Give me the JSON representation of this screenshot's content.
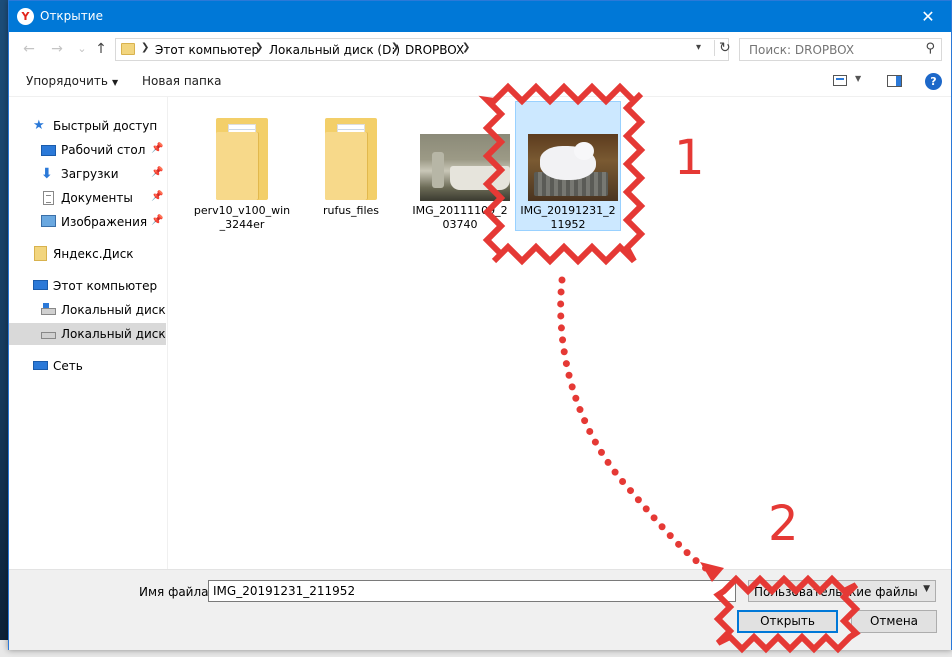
{
  "window": {
    "title": "Открытие",
    "close_glyph": "✕"
  },
  "nav": {
    "back_glyph": "←",
    "forward_glyph": "→",
    "history_glyph": "⌄",
    "up_glyph": "↑",
    "breadcrumbs": [
      "Этот компьютер",
      "Локальный диск (D:)",
      "DROPBOX"
    ],
    "search_placeholder": "Поиск: DROPBOX"
  },
  "toolbar": {
    "organize_label": "Упорядочить",
    "new_folder_label": "Новая папка",
    "help_glyph": "?"
  },
  "sidebar": {
    "items": [
      {
        "label": "Быстрый доступ",
        "icon": "star-icon"
      },
      {
        "label": "Рабочий стол",
        "icon": "desktop-icon",
        "pinned": true
      },
      {
        "label": "Загрузки",
        "icon": "download-icon",
        "pinned": true
      },
      {
        "label": "Документы",
        "icon": "documents-icon",
        "pinned": true
      },
      {
        "label": "Изображения",
        "icon": "pictures-icon",
        "pinned": true
      },
      {
        "label": "Яндекс.Диск",
        "icon": "folder-icon"
      },
      {
        "label": "Этот компьютер",
        "icon": "computer-icon"
      },
      {
        "label": "Локальный диск (C",
        "icon": "system-drive-icon"
      },
      {
        "label": "Локальный диск (D",
        "icon": "drive-icon",
        "selected": true
      },
      {
        "label": "Сеть",
        "icon": "network-icon"
      }
    ]
  },
  "files": [
    {
      "name": "perv10_v100_win_3244er",
      "type": "folder"
    },
    {
      "name": "rufus_files",
      "type": "folder"
    },
    {
      "name": "IMG_20111109_203740",
      "type": "image"
    },
    {
      "name": "IMG_20191231_211952",
      "type": "image",
      "selected": true
    }
  ],
  "bottom": {
    "filename_label": "Имя файла:",
    "filename_value": "IMG_20191231_211952",
    "filetype_value": "Пользовательские файлы",
    "open_label": "Открыть",
    "cancel_label": "Отмена"
  },
  "annotations": {
    "step1": "1",
    "step2": "2",
    "color": "#e53935"
  }
}
